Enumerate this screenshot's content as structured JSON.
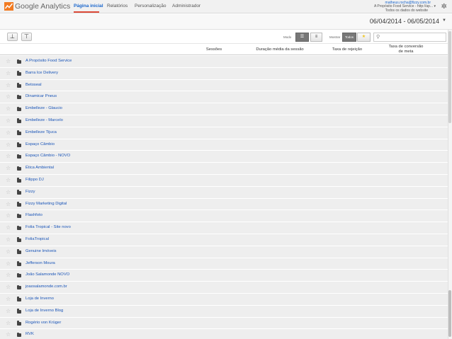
{
  "app": {
    "logo_text": "Google Analytics",
    "logo_icon": "google-analytics-logo-icon"
  },
  "nav": {
    "items": [
      {
        "label": "Página inicial",
        "active": true
      },
      {
        "label": "Relatórios",
        "active": false
      },
      {
        "label": "Personalização",
        "active": false
      },
      {
        "label": "Administrador",
        "active": false
      }
    ]
  },
  "account": {
    "email": "matheus.rocha@fizzy.com.br",
    "property": "A Propósito Food Service - http://ap...",
    "view": "Todos os dados do website"
  },
  "date_range": "06/04/2014 - 06/05/2014",
  "toolbar": {
    "btn1": "⊥",
    "btn2": "⊤",
    "mode_label": "Modo",
    "show_label": "Mostrar",
    "show_all": "Todos",
    "search_placeholder": ""
  },
  "columns": {
    "sessions": "Sessões",
    "avg_duration": "Duração média da sessão",
    "bounce": "Taxa de rejeição",
    "conversion": "Taxa de conversão de meta"
  },
  "rows": [
    "A Propósito Food Service",
    "Barra Ice Delivery",
    "Betoseal",
    "Dinamicar Pneus",
    "Embelleze - Glaucio",
    "Embelleze - Marcelo",
    "Embelleze Tijuca",
    "Espaço Câmbio",
    "Espaço Câmbio - NOVO",
    "Ética Ambiental",
    "Filippo DJ",
    "Fizzy",
    "Fizzy Marketing Digital",
    "Flashfoto",
    "Folia Tropical - Site novo",
    "FoliaTropical",
    "Genuine Imóveis",
    "Jefferson Moura",
    "João Salamonde NOVO",
    "joaosalamonde.com.br",
    "Loja de Inverno",
    "Loja de Inverno Blog",
    "Rogério von Krüger",
    "RVK"
  ],
  "colors": {
    "link": "#1a55b8",
    "row_bg": "#eeeeee",
    "nav_active": "#1a66cc",
    "accent": "#dd4b39"
  }
}
